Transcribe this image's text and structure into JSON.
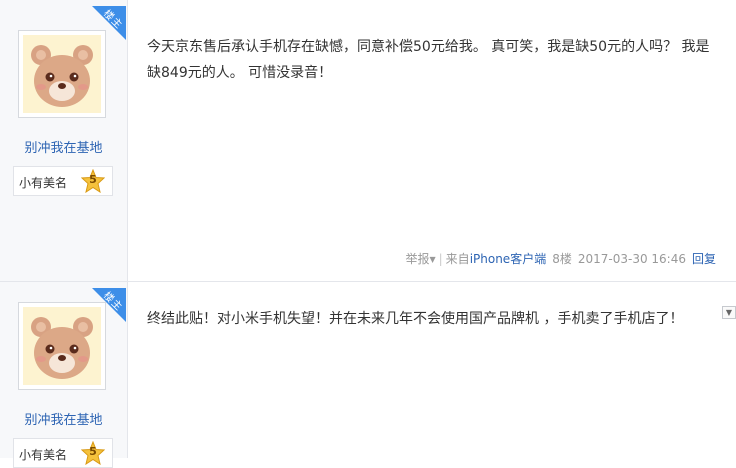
{
  "posts": [
    {
      "badge_label": "楼主",
      "username": "别冲我在基地",
      "level_name": "小有美名",
      "level": "5",
      "content_line1": "今天京东售后承认手机存在缺憾，同意补偿50元给我。 真可笑，我是缺50元的人吗？ 我是",
      "content_line2": "缺849元的人。 可惜没录音！",
      "report_label": "举报",
      "source_prefix": "来自",
      "source_link": "iPhone客户端",
      "floor": "8楼",
      "timestamp": "2017-03-30 16:46",
      "reply_label": "回复"
    },
    {
      "badge_label": "楼主",
      "username": "别冲我在基地",
      "level_name": "小有美名",
      "level": "5",
      "content_line1": "终结此贴！对小米手机失望！并在未来几年不会使用国产品牌机 ，手机卖了手机店了！"
    }
  ],
  "icons": {
    "avatar": "bear-avatar-icon",
    "level": "star-level-icon",
    "caret": "caret-down-icon"
  },
  "colors": {
    "accent": "#3d8ee8",
    "link": "#2d64b3",
    "sidebar_bg": "#f7f8fa",
    "star": "#f5c23c"
  }
}
